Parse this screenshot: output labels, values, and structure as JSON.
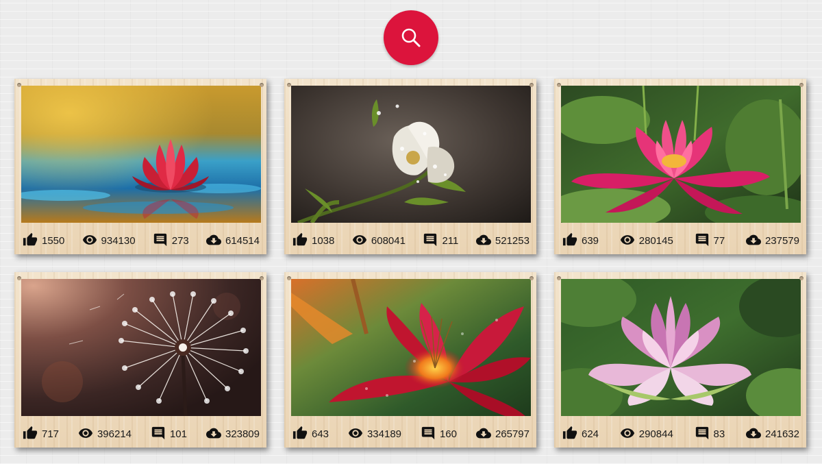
{
  "search": {
    "icon": "search-icon",
    "accent": "#dc143c"
  },
  "cards": [
    {
      "image": "red water lily on blue pond",
      "likes": "1550",
      "views": "934130",
      "comments": "273",
      "downloads": "614514"
    },
    {
      "image": "white blossom with dew drops",
      "likes": "1038",
      "views": "608041",
      "comments": "211",
      "downloads": "521253"
    },
    {
      "image": "pink water lily among lily pads",
      "likes": "639",
      "views": "280145",
      "comments": "77",
      "downloads": "237579"
    },
    {
      "image": "dandelion seed head",
      "likes": "717",
      "views": "396214",
      "comments": "101",
      "downloads": "323809"
    },
    {
      "image": "red lily with water drops",
      "likes": "643",
      "views": "334189",
      "comments": "160",
      "downloads": "265797"
    },
    {
      "image": "pink lotus flower",
      "likes": "624",
      "views": "290844",
      "comments": "83",
      "downloads": "241632"
    }
  ]
}
